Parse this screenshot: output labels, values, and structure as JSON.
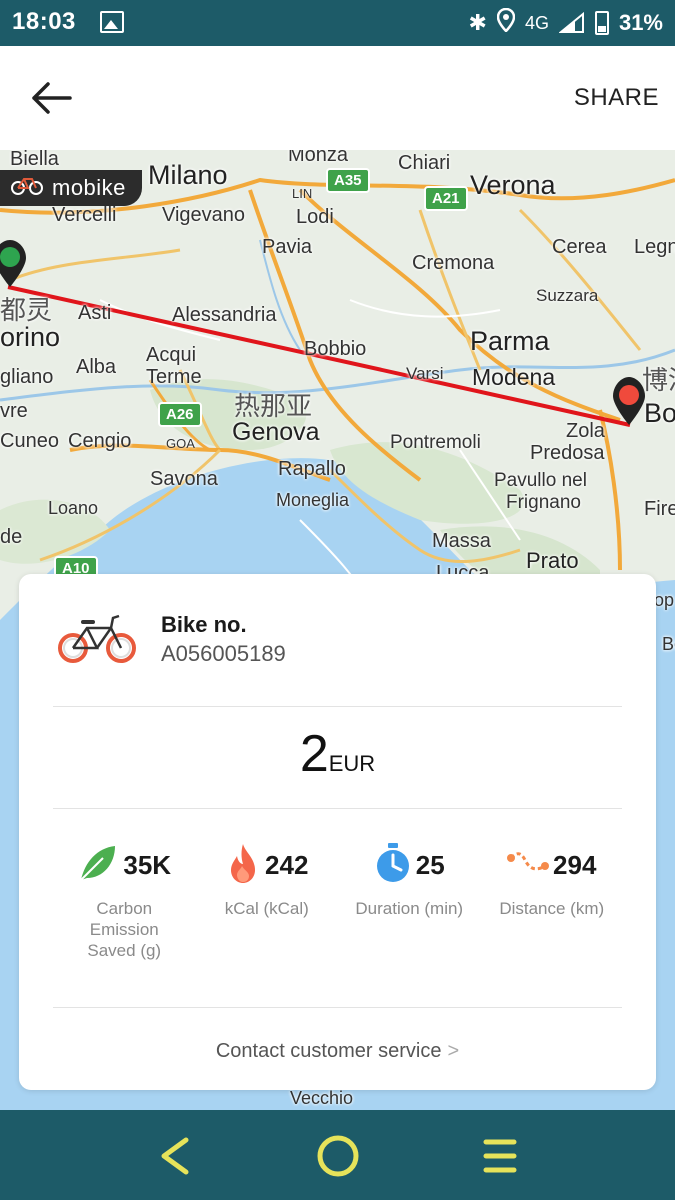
{
  "status_bar": {
    "time": "18:03",
    "network": "4G",
    "battery": "31%"
  },
  "app_bar": {
    "share_label": "SHARE"
  },
  "map": {
    "brand": "mobike",
    "labels": {
      "biella": "Biella",
      "milano": "Milano",
      "monza": "Monza",
      "chiari": "Chiari",
      "verona": "Verona",
      "vercelli": "Vercelli",
      "vigevano": "Vigevano",
      "lin": "LIN",
      "lodi": "Lodi",
      "pavia": "Pavia",
      "cerea": "Cerea",
      "legn": "Legn",
      "cremona": "Cremona",
      "suzzara": "Suzzara",
      "torino_zh": "都灵",
      "orino": "orino",
      "asti": "Asti",
      "alessandria": "Alessandria",
      "parma": "Parma",
      "alba": "Alba",
      "acqui": "Acqui",
      "terme": "Terme",
      "bobbio": "Bobbio",
      "varsi": "Varsi",
      "modena": "Modena",
      "bologna_zh": "博洛",
      "bo": "Bo",
      "gliano": "gliano",
      "genova_zh": "热那亚",
      "vre": "vre",
      "cuneo": "Cuneo",
      "cengio": "Cengio",
      "goa": "GOA",
      "genova": "Genova",
      "pontremoli": "Pontremoli",
      "zola": "Zola",
      "predosa": "Predosa",
      "savona": "Savona",
      "rapallo": "Rapallo",
      "pavullo": "Pavullo nel",
      "frignano": "Frignano",
      "fire": "Fire",
      "loano": "Loano",
      "moneglia": "Moneglia",
      "de": "de",
      "massa": "Massa",
      "prato": "Prato",
      "lucca": "Lucca",
      "vecchio": "Vecchio",
      "op": "op",
      "bo2": "Bo"
    },
    "roads": {
      "a35": "A35",
      "a21": "A21",
      "a26": "A26",
      "a10": "A10"
    },
    "colors": {
      "route": "#e0151b",
      "start_pin": "#2ea44f",
      "end_pin": "#f04a3c",
      "sea": "#a8d3f2"
    }
  },
  "ride": {
    "bike_title": "Bike no.",
    "bike_id": "A056005189",
    "price_amount": "2",
    "price_unit": "EUR",
    "stats": [
      {
        "icon": "leaf-icon",
        "value": "35K",
        "label": "Carbon Emission Saved (g)"
      },
      {
        "icon": "flame-icon",
        "value": "242",
        "label": "kCal (kCal)"
      },
      {
        "icon": "stopwatch-icon",
        "value": "25",
        "label": "Duration (min)"
      },
      {
        "icon": "route-icon",
        "value": "294",
        "label": "Distance (km)"
      }
    ],
    "contact_label": "Contact customer service",
    "contact_chevron": ">"
  }
}
